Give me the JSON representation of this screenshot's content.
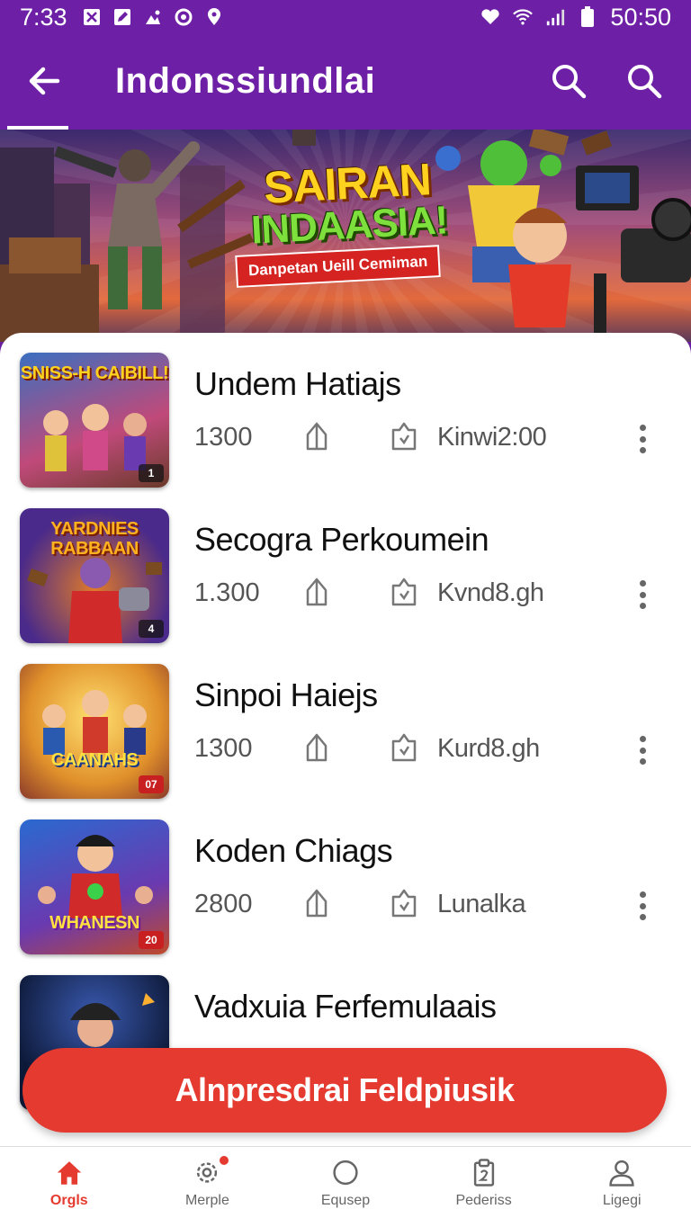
{
  "status_bar": {
    "time": "7:33",
    "clock": "50:50",
    "left_icons": [
      "close-box-icon",
      "edit-box-icon",
      "image-icon",
      "circle-notification-icon",
      "location-icon"
    ],
    "right_icons": [
      "heart-wifi-icon",
      "wifi-icon",
      "signal-icon",
      "battery-icon"
    ]
  },
  "app_bar": {
    "title": "Indonssiundlai",
    "background": "#6d1fa6"
  },
  "banner": {
    "headline_line1": "SAIRAN",
    "headline_line2": "INDAASIA!",
    "ribbon": "Danpetan Ueill Cemiman"
  },
  "list": {
    "items": [
      {
        "title": "Undem Hatiajs",
        "count": "1300",
        "meta": "Kinwi2:00",
        "thumb_text": "SNISS-H CAIBILL!",
        "badge": "1"
      },
      {
        "title": "Secogra Perkoumein",
        "count": "1.300",
        "meta": "Kvnd8.gh",
        "thumb_text": "YARDNIES RABBAAN",
        "badge": "4"
      },
      {
        "title": "Sinpoi Haiejs",
        "count": "1300",
        "meta": "Kurd8.gh",
        "thumb_text": "CAANAHS",
        "badge": "07"
      },
      {
        "title": "Koden Chiags",
        "count": "2800",
        "meta": "Lunalka",
        "thumb_text": "WHANESN",
        "badge": "20"
      },
      {
        "title": "Vadxuia Ferfemulaais",
        "count": "",
        "meta": "",
        "thumb_text": "",
        "badge": ""
      }
    ]
  },
  "cta": {
    "label": "Alnpresdrai Feldpiusik",
    "color": "#e53a2f"
  },
  "bottom_nav": {
    "items": [
      {
        "label": "Orgls",
        "icon": "home-icon",
        "active": true
      },
      {
        "label": "Merple",
        "icon": "gear-icon",
        "active": false
      },
      {
        "label": "Equsep",
        "icon": "circle-icon",
        "active": false
      },
      {
        "label": "Pederiss",
        "icon": "clipboard-icon",
        "active": false
      },
      {
        "label": "Ligegi",
        "icon": "user-icon",
        "active": false
      }
    ]
  }
}
